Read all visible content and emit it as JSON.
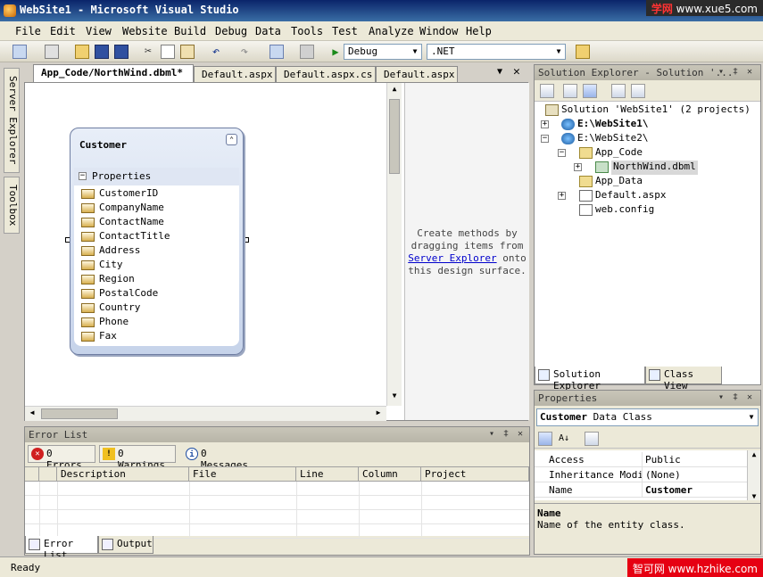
{
  "window": {
    "title": "WebSite1 - Microsoft Visual Studio"
  },
  "watermarks": {
    "top_a": "学网",
    "top_b": "www.xue5.com",
    "bottom": "智可网 www.hzhike.com"
  },
  "menu": [
    "File",
    "Edit",
    "View",
    "Website",
    "Build",
    "Debug",
    "Data",
    "Tools",
    "Test",
    "Analyze",
    "Window",
    "Help"
  ],
  "toolbar": {
    "config": "Debug",
    "platform": ".NET"
  },
  "side_tabs": [
    "Server Explorer",
    "Toolbox"
  ],
  "doc_tabs": [
    "App_Code/NorthWind.dbml*",
    "Default.aspx",
    "Default.aspx.cs",
    "Default.aspx"
  ],
  "design": {
    "entity_name": "Customer",
    "section": "Properties",
    "properties": [
      "CustomerID",
      "CompanyName",
      "ContactName",
      "ContactTitle",
      "Address",
      "City",
      "Region",
      "PostalCode",
      "Country",
      "Phone",
      "Fax"
    ],
    "hint_l1": "Create methods by",
    "hint_l2": "dragging items from",
    "hint_link": "Server Explorer",
    "hint_l3_tail": " onto",
    "hint_l4": "this design surface."
  },
  "error_list": {
    "title": "Error List",
    "errors": "0 Errors",
    "warnings": "0 Warnings",
    "messages": "0 Messages",
    "columns": [
      "Description",
      "File",
      "Line",
      "Column",
      "Project"
    ],
    "tab_error": "Error List",
    "tab_output": "Output"
  },
  "solution": {
    "title": "Solution Explorer - Solution '...",
    "root": "Solution 'WebSite1' (2 projects)",
    "site1": "E:\\WebSite1\\",
    "site2": "E:\\WebSite2\\",
    "app_code": "App_Code",
    "northwind": "NorthWind.dbml",
    "app_data": "App_Data",
    "default": "Default.aspx",
    "webconfig": "web.config",
    "tab_sol": "Solution Explorer",
    "tab_class": "Class View"
  },
  "properties": {
    "title": "Properties",
    "object": "Customer",
    "object_type": " Data Class",
    "rows": [
      {
        "k": "Access",
        "v": "Public"
      },
      {
        "k": "Inheritance Modif",
        "v": "(None)"
      },
      {
        "k": "Name",
        "v": "Customer"
      }
    ],
    "desc_title": "Name",
    "desc_text": "Name of the entity class."
  },
  "status": "Ready"
}
